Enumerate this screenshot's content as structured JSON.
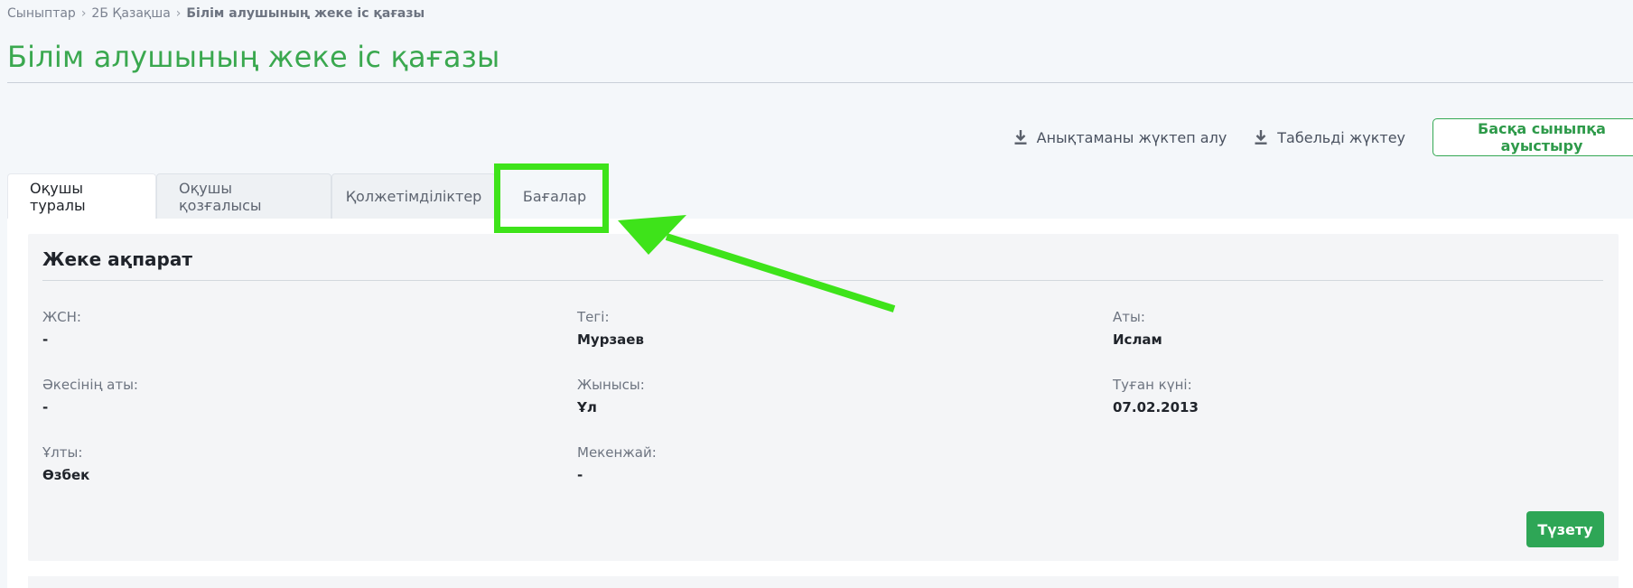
{
  "breadcrumb": {
    "items": [
      "Сыныптар",
      "2Б Қазақша"
    ],
    "current": "Білім алушының жеке іс қағазы"
  },
  "page": {
    "title": "Білім алушының жеке іс қағазы"
  },
  "toolbar": {
    "download_certificate": "Анықтаманы жүктеп алу",
    "download_timesheet": "Табельді жүктеу",
    "transfer_button": "Басқа сыныпқа ауыстыру",
    "icon": "download-icon"
  },
  "tabs": [
    {
      "label": "Оқушы туралы",
      "active": true
    },
    {
      "label": "Оқушы қозғалысы",
      "active": false
    },
    {
      "label": "Қолжетімділіктер",
      "active": false
    },
    {
      "label": "Бағалар",
      "active": false
    }
  ],
  "personal_info": {
    "title": "Жеке ақпарат",
    "fields": {
      "iin": {
        "label": "ЖСН:",
        "value": "-"
      },
      "surname": {
        "label": "Тегі:",
        "value": "Мурзаев"
      },
      "name": {
        "label": "Аты:",
        "value": "Ислам"
      },
      "patronymic": {
        "label": "Әкесінің аты:",
        "value": "-"
      },
      "gender": {
        "label": "Жынысы:",
        "value": "Ұл"
      },
      "birth_date": {
        "label": "Туған күні:",
        "value": "07.02.2013"
      },
      "nationality": {
        "label": "Ұлты:",
        "value": "Өзбек"
      },
      "address": {
        "label": "Мекенжай:",
        "value": "-"
      }
    },
    "edit_button": "Түзету"
  },
  "annotation": {
    "color": "#3ee31a",
    "target": "Бағалар"
  },
  "colors": {
    "accent": "#3aa84f",
    "button": "#2ea656"
  }
}
